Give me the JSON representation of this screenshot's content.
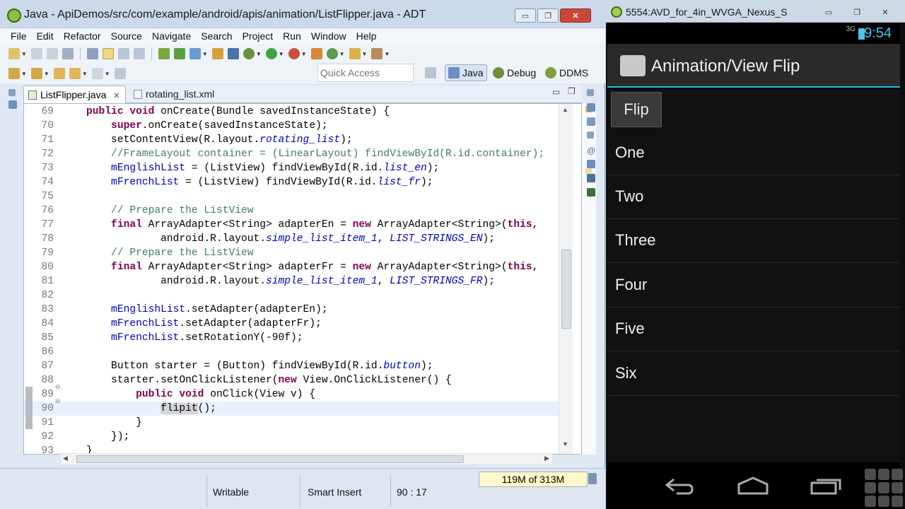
{
  "ide": {
    "title": "Java - ApiDemos/src/com/example/android/apis/animation/ListFlipper.java - ADT",
    "window_buttons": {
      "minimize": "▭",
      "restore": "❐",
      "close": "✕"
    },
    "menu": [
      "File",
      "Edit",
      "Refactor",
      "Source",
      "Navigate",
      "Search",
      "Project",
      "Run",
      "Window",
      "Help"
    ],
    "quick_access_placeholder": "Quick Access",
    "perspectives": {
      "java": "Java",
      "debug": "Debug",
      "ddms": "DDMS"
    },
    "tabs": [
      {
        "label": "ListFlipper.java",
        "active": true,
        "close": "✕"
      },
      {
        "label": "rotating_list.xml",
        "active": false
      }
    ],
    "status": {
      "writable": "Writable",
      "insert_mode": "Smart Insert",
      "position": "90 : 17",
      "heap": "119M of 313M"
    },
    "colors": {
      "keyword": "#7f0055",
      "field": "#0000c0",
      "comment": "#3f7f5f",
      "current_line": "#e8f2fe"
    }
  },
  "code_lines": [
    {
      "n": "69"
    },
    {
      "n": "70"
    },
    {
      "n": "71"
    },
    {
      "n": "72"
    },
    {
      "n": "73"
    },
    {
      "n": "74"
    },
    {
      "n": "75"
    },
    {
      "n": "76"
    },
    {
      "n": "77"
    },
    {
      "n": "78"
    },
    {
      "n": "79"
    },
    {
      "n": "80"
    },
    {
      "n": "81"
    },
    {
      "n": "82"
    },
    {
      "n": "83"
    },
    {
      "n": "84"
    },
    {
      "n": "85"
    },
    {
      "n": "86"
    },
    {
      "n": "87"
    },
    {
      "n": "88"
    },
    {
      "n": "89"
    },
    {
      "n": "90"
    },
    {
      "n": "91"
    },
    {
      "n": "92"
    },
    {
      "n": "93"
    }
  ],
  "code": {
    "l69a": "    public void",
    "l69b": " onCreate(Bundle savedInstanceState) {",
    "l70a": "        super",
    "l70b": ".onCreate(savedInstanceState);",
    "l71a": "        setContentView(R.layout.",
    "l71b": "rotating_list",
    "l71c": ");",
    "l72": "        //FrameLayout container = (LinearLayout) findViewById(R.id.container);",
    "l73a": "        mEnglishList",
    "l73b": " = (ListView) findViewById(R.id.",
    "l73c": "list_en",
    "l73d": ");",
    "l74a": "        mFrenchList",
    "l74b": " = (ListView) findViewById(R.id.",
    "l74c": "list_fr",
    "l74d": ");",
    "l76": "        // Prepare the ListView",
    "l77a": "        final",
    "l77b": " ArrayAdapter<String> adapterEn = ",
    "l77c": "new",
    "l77d": " ArrayAdapter<String>(",
    "l77e": "this",
    "l77f": ",",
    "l78a": "                android.R.layout.",
    "l78b": "simple_list_item_1",
    "l78c": ", ",
    "l78d": "LIST_STRINGS_EN",
    "l78e": ");",
    "l79": "        // Prepare the ListView",
    "l80a": "        final",
    "l80b": " ArrayAdapter<String> adapterFr = ",
    "l80c": "new",
    "l80d": " ArrayAdapter<String>(",
    "l80e": "this",
    "l80f": ",",
    "l81a": "                android.R.layout.",
    "l81b": "simple_list_item_1",
    "l81c": ", ",
    "l81d": "LIST_STRINGS_FR",
    "l81e": ");",
    "l83a": "        mEnglishList",
    "l83b": ".setAdapter(adapterEn);",
    "l84a": "        mFrenchList",
    "l84b": ".setAdapter(adapterFr);",
    "l85a": "        mFrenchList",
    "l85b": ".setRotationY(-90f);",
    "l87a": "        Button starter = (Button) findViewById(R.id.",
    "l87b": "button",
    "l87c": ");",
    "l88a": "        starter.setOnClickListener(",
    "l88b": "new",
    "l88c": " View.OnClickListener() {",
    "l89a": "            public void",
    "l89b": " onClick(View v) {",
    "l90a": "                ",
    "l90b": "flipit",
    "l90c": "();",
    "l91": "            }",
    "l92": "        });",
    "l93": "    }"
  },
  "emulator": {
    "title": "5554:AVD_for_4in_WVGA_Nexus_S",
    "signal": "3G",
    "clock": "9:54",
    "app_title": "Animation/View Flip",
    "flip_button": "Flip",
    "items": [
      "One",
      "Two",
      "Three",
      "Four",
      "Five",
      "Six"
    ],
    "nav_icons": [
      "back-icon",
      "home-icon",
      "recents-icon"
    ],
    "accent": "#33b5e5"
  }
}
